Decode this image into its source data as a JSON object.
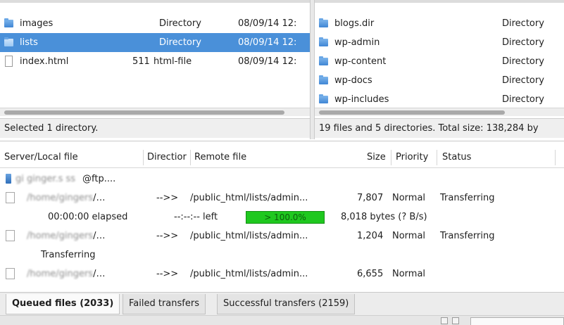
{
  "local": {
    "rows": [
      {
        "name": "images",
        "size": "",
        "type": "Directory",
        "modified": "08/09/14 12:",
        "icon": "folder-icon",
        "selected": false
      },
      {
        "name": "lists",
        "size": "",
        "type": "Directory",
        "modified": "08/09/14 12:",
        "icon": "folder-icon",
        "selected": true
      },
      {
        "name": "index.html",
        "size": "511",
        "type": "html-file",
        "modified": "08/09/14 12:",
        "icon": "file-icon",
        "selected": false
      }
    ],
    "status": "Selected 1 directory."
  },
  "remote": {
    "rows": [
      {
        "name": "blogs.dir",
        "type": "Directory",
        "icon": "folder-icon"
      },
      {
        "name": "wp-admin",
        "type": "Directory",
        "icon": "folder-icon"
      },
      {
        "name": "wp-content",
        "type": "Directory",
        "icon": "folder-icon"
      },
      {
        "name": "wp-docs",
        "type": "Directory",
        "icon": "folder-icon"
      },
      {
        "name": "wp-includes",
        "type": "Directory",
        "icon": "folder-icon"
      }
    ],
    "status": "19 files and 5 directories. Total size: 138,284 by"
  },
  "queue": {
    "headers": {
      "server_local": "Server/Local file",
      "direction": "Directior",
      "remote": "Remote file",
      "size": "Size",
      "priority": "Priority",
      "status": "Status"
    },
    "server": "@ftp....",
    "items": [
      {
        "local": "/…",
        "direction": "-->>",
        "remote": "/public_html/lists/admin...",
        "size": "7,807",
        "priority": "Normal",
        "status": "Transferring"
      },
      {
        "local": "/…",
        "direction": "-->>",
        "remote": "/public_html/lists/admin...",
        "size": "1,204",
        "priority": "Normal",
        "status": "Transferring"
      },
      {
        "local": "/…",
        "direction": "-->>",
        "remote": "/public_html/lists/admin...",
        "size": "6,655",
        "priority": "Normal",
        "status": ""
      }
    ],
    "progress": {
      "elapsed": "00:00:00 elapsed",
      "left": "--:--:-- left",
      "percent_label": "> 100.0%",
      "percent": 100,
      "rate": "8,018 bytes (? B/s)"
    },
    "transferring_label": "Transferring"
  },
  "tabs": [
    {
      "label": "Queued files (2033)",
      "active": true
    },
    {
      "label": "Failed transfers",
      "active": false
    },
    {
      "label": "Successful transfers (2159)",
      "active": false
    }
  ],
  "colors": {
    "selection": "#4a90d9",
    "progress": "#1fc81f"
  }
}
